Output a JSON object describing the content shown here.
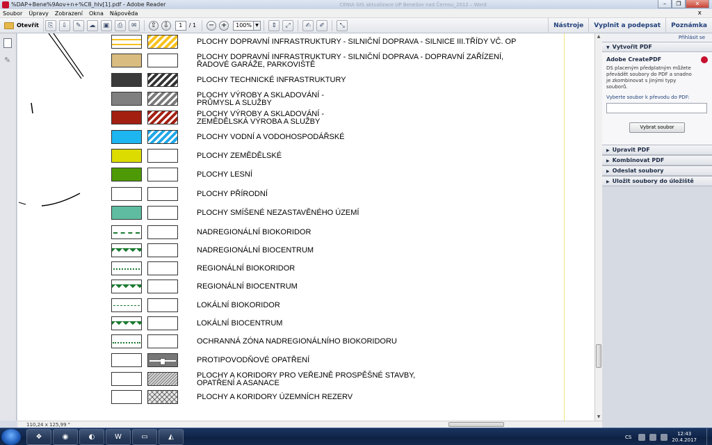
{
  "window": {
    "title": "%DAP+Bene%9Aov+n+%C8_hlv[1].pdf - Adobe Reader",
    "ghost_title": "CENIA GIS aktualizace UP Benešov nad Černou_2012 – Word"
  },
  "menu": [
    "Soubor",
    "Úpravy",
    "Zobrazení",
    "Okna",
    "Nápověda"
  ],
  "menu_close": "x",
  "toolbar": {
    "open_label": "Otevřít",
    "page_current": "1",
    "page_total": "/ 1",
    "zoom": "100%",
    "zoom_out": "−",
    "zoom_in": "+",
    "tools_label": "Nástroje",
    "fill_sign_label": "Vyplnit a podepsat",
    "comment_label": "Poznámka"
  },
  "legend": [
    {
      "label": "PLOCHY DOPRAVNÍ INFRASTRUKTURY - SILNIČNÍ DOPRAVA - SILNICE III.TŘÍDY VČ. OP",
      "sw1": "road",
      "sw2": "hatch-yellow"
    },
    {
      "label": "PLOCHY DOPRAVNÍ INFRASTRUKTURY - SILNIČNÍ DOPRAVA - DOPRAVNÍ ZAŘÍZENÍ,",
      "label2": "ŘADOVÉ GARÁŽE, PARKOVIŠTĚ",
      "sw1": "#d9bd80",
      "sw2": "white"
    },
    {
      "label": "PLOCHY TECHNICKÉ INFRASTRUKTURY",
      "sw1": "#3a3a3a",
      "sw2": "hatch-dark"
    },
    {
      "label": "PLOCHY VÝROBY A SKLADOVÁNÍ -",
      "label2": "PRŮMYSL A SLUŽBY",
      "sw1": "#7f7f7f",
      "sw2": "hatch-grey"
    },
    {
      "label": "PLOCHY VÝROBY A SKLADOVÁNÍ -",
      "label2": "ZEMĚDĚLSKÁ VÝROBA A SLUŽBY",
      "sw1": "#a32011",
      "sw2": "hatch-red"
    },
    {
      "label": "PLOCHY VODNÍ A VODOHOSPODÁŘSKÉ",
      "sw1": "#1eb6f0",
      "sw2": "hatch-blue"
    },
    {
      "label": "PLOCHY ZEMĚDĚLSKÉ",
      "sw1": "#dcdc00",
      "sw2": "white"
    },
    {
      "label": "PLOCHY LESNÍ",
      "sw1": "#4e9a06",
      "sw2": "white"
    },
    {
      "label": "PLOCHY PŘÍRODNÍ",
      "sw1": "white",
      "sw2": "white"
    },
    {
      "label": "PLOCHY SMÍŠENÉ NEZASTAVĚNÉHO ÚZEMÍ",
      "sw1": "#5fbca0",
      "sw2": "white"
    },
    {
      "label": "NADREGIONÁLNÍ BIOKORIDOR",
      "sw1": "line-dash",
      "sw2": "white"
    },
    {
      "label": "NADREGIONÁLNÍ BIOCENTRUM",
      "sw1": "center",
      "sw2": "white"
    },
    {
      "label": "REGIONÁLNÍ BIOKORIDOR",
      "sw1": "line-dashdot",
      "sw2": "white"
    },
    {
      "label": "REGIONÁLNÍ BIOCENTRUM",
      "sw1": "center",
      "sw2": "white"
    },
    {
      "label": "LOKÁLNÍ BIOKORIDOR",
      "sw1": "line-short",
      "sw2": "white"
    },
    {
      "label": "LOKÁLNÍ BIOCENTRUM",
      "sw1": "center",
      "sw2": "white"
    },
    {
      "label": "OCHRANNÁ ZÓNA NADREGIONÁLNÍHO BIOKORIDORU",
      "sw1": "line-solid",
      "sw2": "white"
    },
    {
      "label": "PROTIPOVODŇOVÉ OPATŘENÍ",
      "sw1": "white",
      "sw2": "dike"
    },
    {
      "label": "PLOCHY A KORIDORY PRO VEŘEJNĚ PROSPĚŠNÉ STAVBY,",
      "label2": "OPATŘENÍ A ASANACE",
      "sw1": "white",
      "sw2": "hatch-fine"
    },
    {
      "label": "PLOCHY A KORIDORY ÚZEMNÍCH REZERV",
      "sw1": "white",
      "sw2": "cross"
    }
  ],
  "status": {
    "page_size": "110,24 x 125,99 \""
  },
  "right_pane": {
    "login": "Přihlásit se",
    "create_pdf": {
      "header": "Vytvořit PDF",
      "service_title": "Adobe CreatePDF",
      "description": "DS placeným předplatným můžete převádět soubory do PDF a snadno je zkombinovat s jinými typy souborů.",
      "select_label": "Vyberte soubor k převodu do PDF:",
      "select_button": "Vybrat soubor"
    },
    "panels": [
      "Upravit PDF",
      "Kombinovat PDF",
      "Odeslat soubory",
      "Uložit soubory do úložiště"
    ]
  },
  "taskbar": {
    "apps": [
      "explorer",
      "firefox",
      "media",
      "word",
      "folder",
      "acrobat"
    ],
    "language": "CS",
    "time": "12:43",
    "date": "20.4.2017"
  }
}
